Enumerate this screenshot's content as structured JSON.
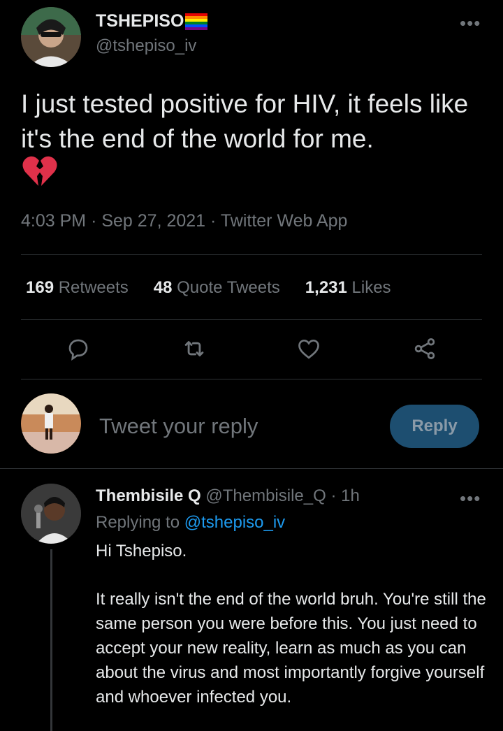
{
  "tweet": {
    "author_name": "TSHEPISO",
    "author_handle": "@tshepiso_iv",
    "more": "•••",
    "text": "I just tested positive for HIV, it feels like it's the end of the world for me.",
    "emoji": "broken-heart-icon",
    "time": "4:03 PM",
    "date": "Sep 27, 2021",
    "source": "Twitter Web App",
    "sep": "·"
  },
  "stats": {
    "retweets_count": "169",
    "retweets_label": "Retweets",
    "quotes_count": "48",
    "quotes_label": "Quote Tweets",
    "likes_count": "1,231",
    "likes_label": "Likes"
  },
  "actions": [
    "reply-icon",
    "retweet-icon",
    "like-icon",
    "share-icon"
  ],
  "composer": {
    "placeholder": "Tweet your reply",
    "button_label": "Reply"
  },
  "reply": {
    "author_name": "Thembisile Q",
    "author_handle": "@Thembisile_Q",
    "time": "1h",
    "sep": "·",
    "more": "•••",
    "replying_to_prefix": "Replying to",
    "replying_to_handle": "@tshepiso_iv",
    "greeting": "Hi Tshepiso.",
    "body": "It really isn't the end of the world bruh. You're still the same person you were before this. You just need to accept your new reality, learn as much as you can about the virus and most importantly forgive yourself and whoever infected you."
  },
  "colors": {
    "background": "#000000",
    "text": "#e7e9ea",
    "muted": "#71767b",
    "accent": "#1d9bf0",
    "reply_button": "#1d4e70"
  }
}
